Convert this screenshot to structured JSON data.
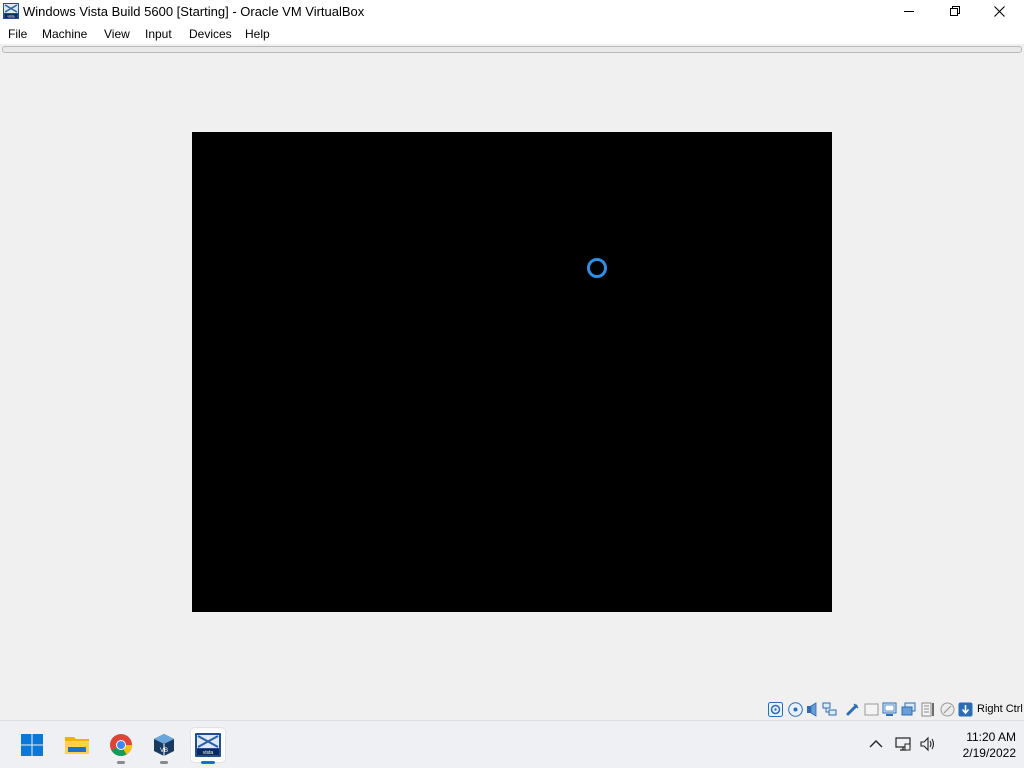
{
  "window": {
    "title": "Windows Vista Build 5600 [Starting] - Oracle VM VirtualBox",
    "app_icon": "vista-vm-icon",
    "controls": {
      "minimize": "minimize-icon",
      "maximize": "restore-icon",
      "close": "close-icon"
    }
  },
  "menubar": {
    "items": [
      {
        "label": "File"
      },
      {
        "label": "Machine"
      },
      {
        "label": "View"
      },
      {
        "label": "Input"
      },
      {
        "label": "Devices"
      },
      {
        "label": "Help"
      }
    ]
  },
  "vm_display": {
    "background": "#000000",
    "spinner_color": "#2f8ee6"
  },
  "statusbar": {
    "icons": [
      "hard-disk-icon",
      "optical-drive-icon",
      "audio-icon",
      "network-icon",
      "usb-icon",
      "shared-folders-icon",
      "display-icon",
      "video-capture-icon",
      "cpu-icon",
      "mouse-integration-icon",
      "keyboard-capture-icon"
    ],
    "host_key": "Right Ctrl"
  },
  "taskbar": {
    "items": [
      "start-icon",
      "file-explorer-icon",
      "chrome-icon",
      "virtualbox-icon",
      "vista-vm-icon"
    ],
    "active_item": "vista-vm-icon",
    "tray": [
      "chevron-up-icon",
      "network-icon",
      "volume-icon"
    ],
    "time": "11:20 AM",
    "date": "2/19/2022"
  },
  "colors": {
    "accent": "#1a6fd0",
    "window_bg": "#f0f0f0"
  }
}
